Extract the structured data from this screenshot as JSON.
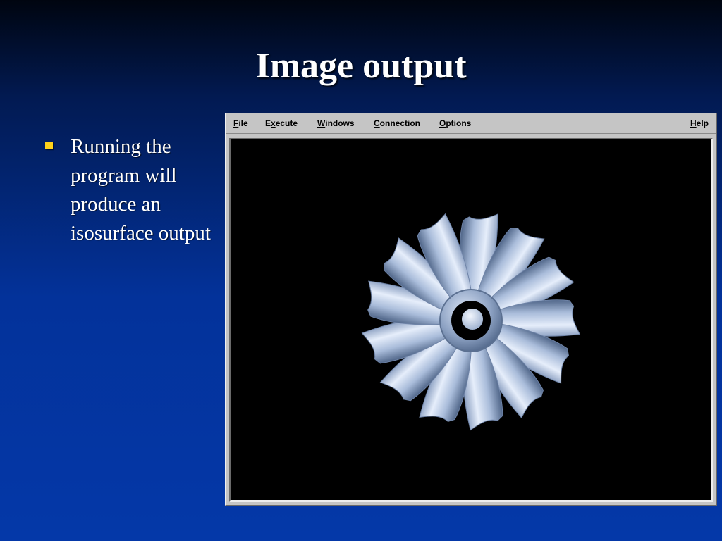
{
  "slide": {
    "title": "Image output",
    "bullets": [
      "Running the program will produce an isosurface output"
    ]
  },
  "menu": {
    "file": {
      "mnemonic": "F",
      "rest": "ile"
    },
    "execute": {
      "before": "E",
      "mnemonic": "x",
      "rest": "ecute"
    },
    "windows": {
      "mnemonic": "W",
      "rest": "indows"
    },
    "connection": {
      "mnemonic": "C",
      "rest": "onnection"
    },
    "options": {
      "mnemonic": "O",
      "rest": "ptions"
    },
    "help": {
      "mnemonic": "H",
      "rest": "elp"
    }
  },
  "render": {
    "subject": "isosurface-fan-impeller",
    "blade_count": 13,
    "colors": {
      "background": "#000000",
      "surface": "#a9bcda",
      "surface_highlight": "#e6eefb",
      "surface_shadow": "#4f6588",
      "bullet": "#ffd21a"
    }
  }
}
